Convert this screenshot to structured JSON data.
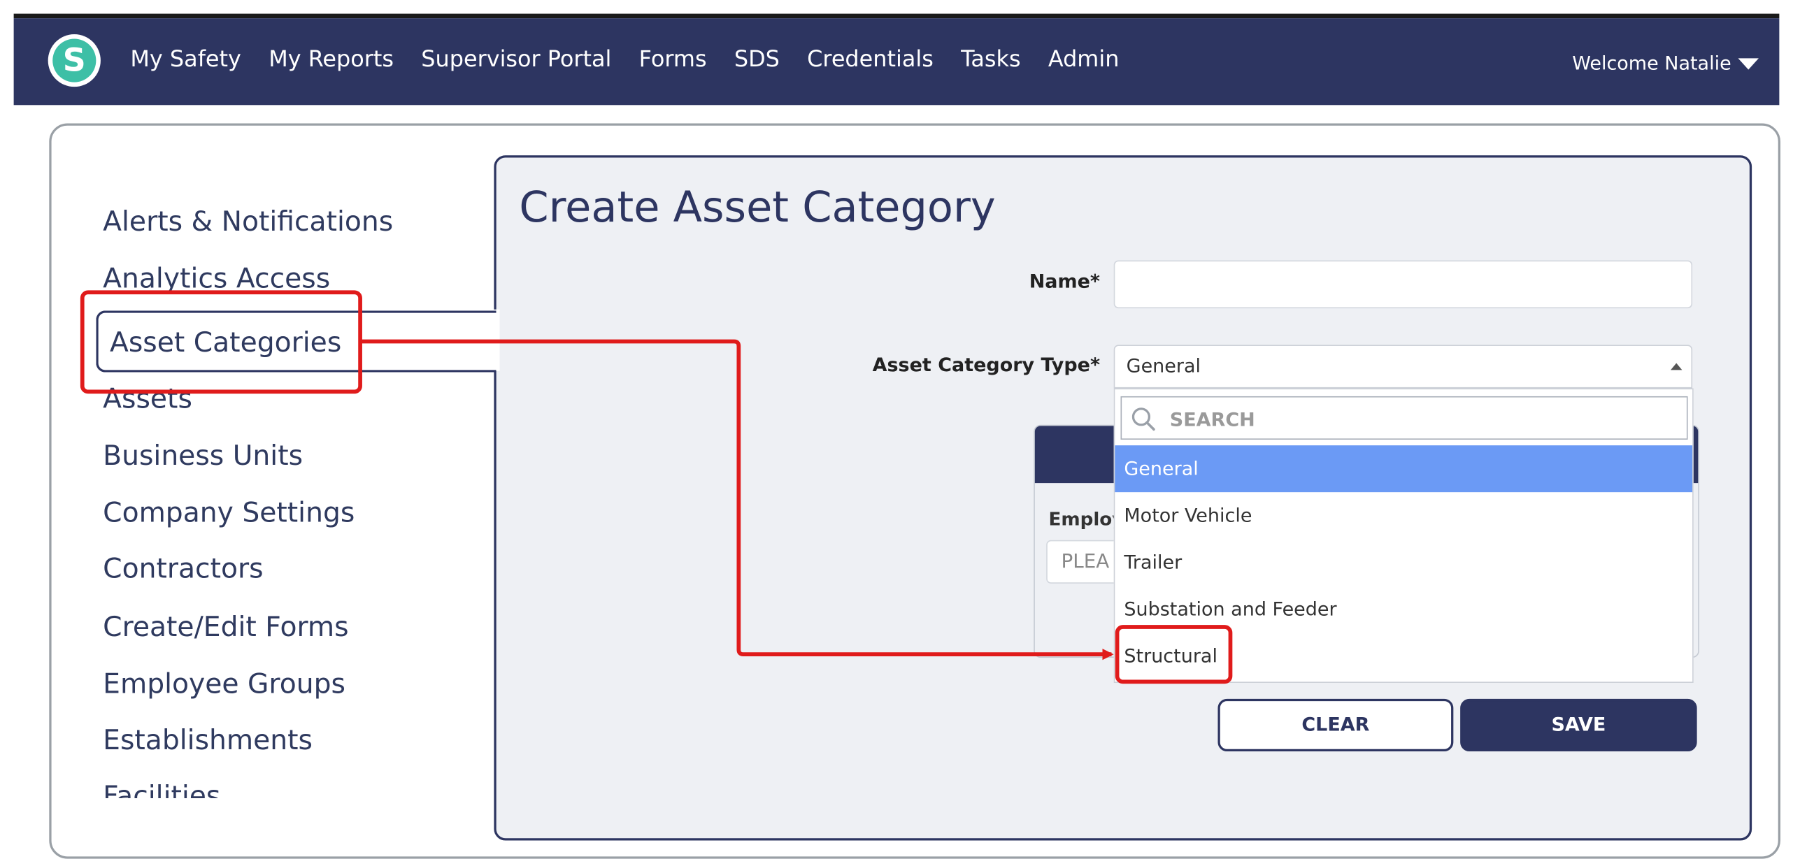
{
  "nav": {
    "logo_letter": "S",
    "links": [
      "My Safety",
      "My Reports",
      "Supervisor Portal",
      "Forms",
      "SDS",
      "Credentials",
      "Tasks",
      "Admin"
    ],
    "welcome": "Welcome Natalie"
  },
  "sidebar": {
    "items": [
      {
        "label": "Alerts & Notifications",
        "active": false
      },
      {
        "label": "Analytics Access",
        "active": false
      },
      {
        "label": "Asset Categories",
        "active": true
      },
      {
        "label": "Assets",
        "active": false
      },
      {
        "label": "Business Units",
        "active": false
      },
      {
        "label": "Company Settings",
        "active": false
      },
      {
        "label": "Contractors",
        "active": false
      },
      {
        "label": "Create/Edit Forms",
        "active": false
      },
      {
        "label": "Employee Groups",
        "active": false
      },
      {
        "label": "Establishments",
        "active": false
      },
      {
        "label": "Facilities",
        "active": false
      }
    ]
  },
  "main": {
    "title": "Create Asset Category",
    "name_label": "Name*",
    "name_value": "",
    "type_label": "Asset Category Type*",
    "type_value": "General",
    "dropdown": {
      "search_placeholder": "SEARCH",
      "options": [
        "General",
        "Motor Vehicle",
        "Trailer",
        "Substation and Feeder",
        "Structural"
      ],
      "selected": "General"
    },
    "obscured_label": "Employ",
    "obscured_input_text": "PLEA",
    "clear_label": "CLEAR",
    "save_label": "SAVE"
  },
  "colors": {
    "navbar": "#2d3561",
    "accent_teal": "#3dbfa6",
    "selected_option": "#6b9af5",
    "annotation_red": "#e01b1b"
  }
}
